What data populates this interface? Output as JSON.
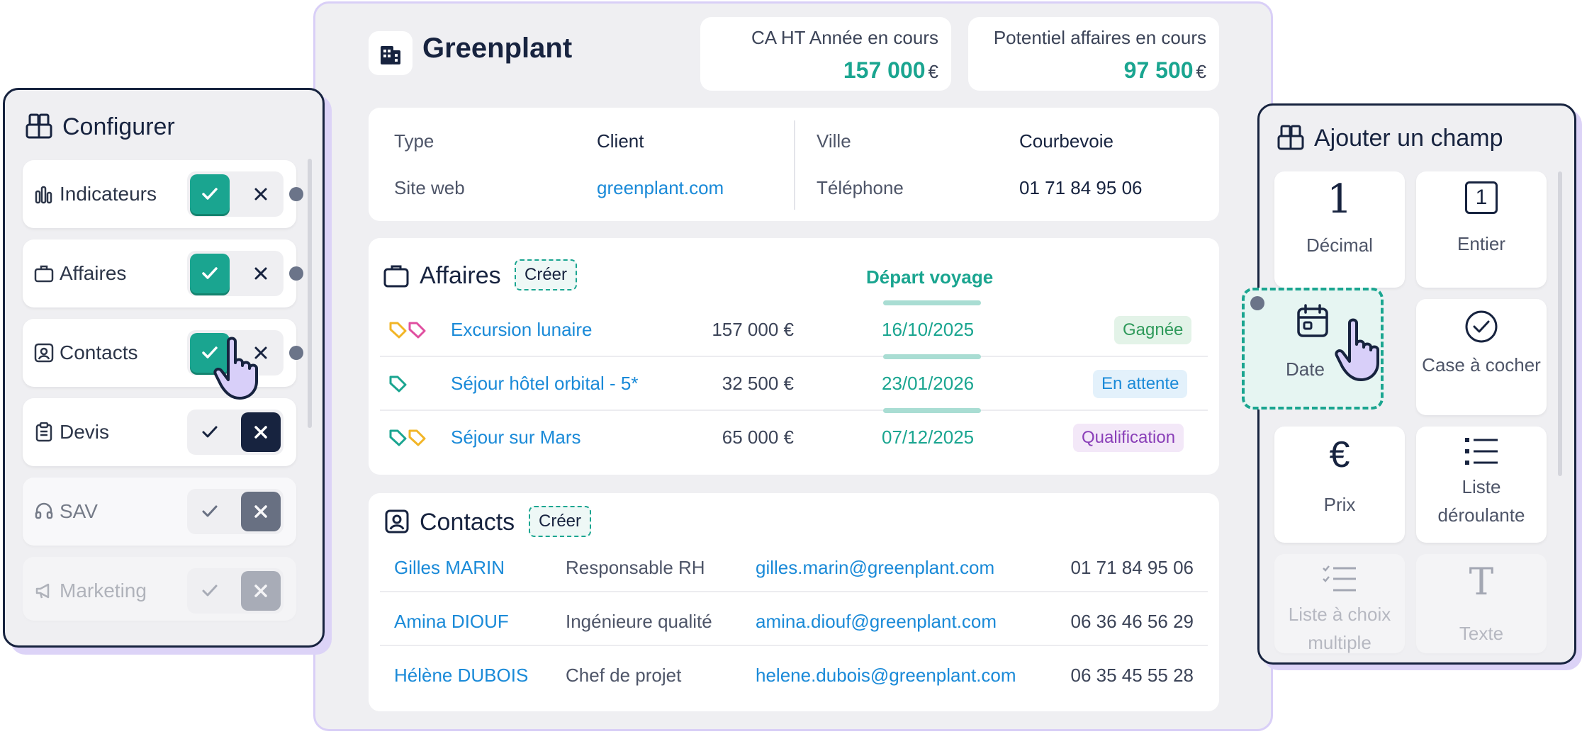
{
  "company": {
    "name": "Greenplant"
  },
  "kpis": {
    "ca": {
      "label": "CA HT Année en cours",
      "value": "157 000",
      "currency": "€"
    },
    "potentiel": {
      "label": "Potentiel affaires en cours",
      "value": "97 500",
      "currency": "€"
    }
  },
  "info": {
    "type_label": "Type",
    "type_value": "Client",
    "site_label": "Site web",
    "site_value": "greenplant.com",
    "ville_label": "Ville",
    "ville_value": "Courbevoie",
    "tel_label": "Téléphone",
    "tel_value": "01 71 84 95 06"
  },
  "affaires": {
    "title": "Affaires",
    "create_label": "Créer",
    "date_column_label": "Départ voyage",
    "rows": [
      {
        "name": "Excursion lunaire",
        "amount": "157 000 €",
        "date": "16/10/2025",
        "status": "Gagnée"
      },
      {
        "name": "Séjour hôtel orbital - 5*",
        "amount": "32 500 €",
        "date": "23/01/2026",
        "status": "En attente"
      },
      {
        "name": "Séjour sur Mars",
        "amount": "65 000 €",
        "date": "07/12/2025",
        "status": "Qualification"
      }
    ]
  },
  "contacts": {
    "title": "Contacts",
    "create_label": "Créer",
    "rows": [
      {
        "name": "Gilles MARIN",
        "role": "Responsable RH",
        "email": "gilles.marin@greenplant.com",
        "phone": "01 71 84 95 06"
      },
      {
        "name": "Amina DIOUF",
        "role": "Ingénieure qualité",
        "email": "amina.diouf@greenplant.com",
        "phone": "06 36 46 56 29"
      },
      {
        "name": "Hélène DUBOIS",
        "role": "Chef de projet",
        "email": "helene.dubois@greenplant.com",
        "phone": "06 35 45 55 28"
      }
    ]
  },
  "configurer": {
    "title": "Configurer",
    "modules": [
      {
        "label": "Indicateurs",
        "icon": "bar-chart-icon",
        "enabled": true
      },
      {
        "label": "Affaires",
        "icon": "briefcase-icon",
        "enabled": true
      },
      {
        "label": "Contacts",
        "icon": "contact-card-icon",
        "enabled": true
      },
      {
        "label": "Devis",
        "icon": "clipboard-icon",
        "enabled": false
      },
      {
        "label": "SAV",
        "icon": "headset-icon",
        "enabled": false
      },
      {
        "label": "Marketing",
        "icon": "megaphone-icon",
        "enabled": false
      }
    ]
  },
  "ajouter_champ": {
    "title": "Ajouter un champ",
    "fields": [
      {
        "label": "Décimal",
        "icon": "decimal-one-icon"
      },
      {
        "label": "Entier",
        "icon": "integer-box-icon"
      },
      {
        "label": "Date",
        "icon": "calendar-icon"
      },
      {
        "label": "Case à cocher",
        "icon": "check-circle-icon"
      },
      {
        "label": "Prix",
        "icon": "euro-icon"
      },
      {
        "label": "Liste déroulante",
        "icon": "list-icon"
      },
      {
        "label": "Liste à choix multiple",
        "icon": "checklist-icon"
      },
      {
        "label": "Texte",
        "icon": "text-icon"
      }
    ],
    "decimal_glyph": "1",
    "integer_glyph": "1",
    "euro_glyph": "€",
    "text_glyph": "T"
  },
  "colors": {
    "accent": "#1aa590",
    "navy": "#17233f",
    "link": "#1a8ad8",
    "frame_lavender": "#d9cff7",
    "status_won": "#2f9a5b",
    "status_pending": "#1a8ad8",
    "status_qualification": "#8a3fb8"
  }
}
